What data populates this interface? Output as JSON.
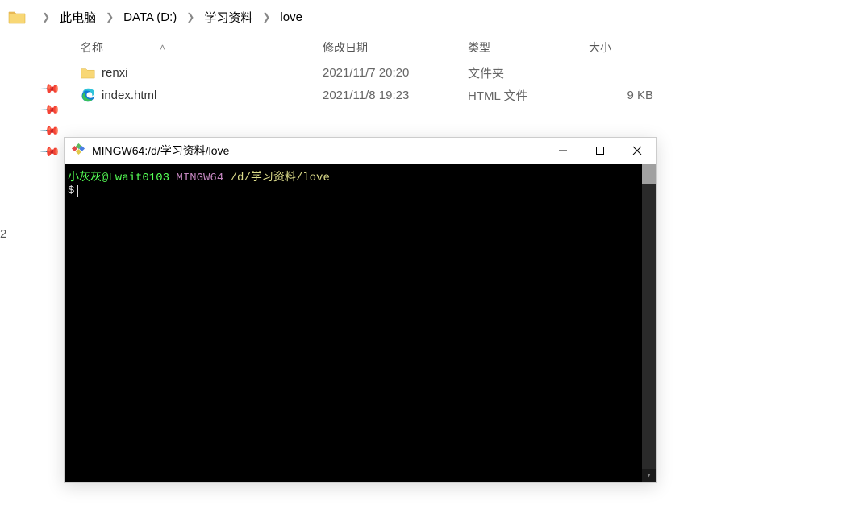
{
  "breadcrumb": {
    "segments": [
      "此电脑",
      "DATA (D:)",
      "学习资料",
      "love"
    ]
  },
  "columns": {
    "name": "名称",
    "date": "修改日期",
    "type": "类型",
    "size": "大小"
  },
  "files": [
    {
      "icon": "folder",
      "name": "renxi",
      "date": "2021/11/7 20:20",
      "type": "文件夹",
      "size": ""
    },
    {
      "icon": "edge",
      "name": "index.html",
      "date": "2021/11/8 19:23",
      "type": "HTML 文件",
      "size": "9 KB"
    }
  ],
  "left_strip": {
    "number": "2"
  },
  "terminal": {
    "title": "MINGW64:/d/学习资料/love",
    "prompt_user": "小灰灰@Lwait0103",
    "prompt_env": "MINGW64",
    "prompt_path": "/d/学习资料/love",
    "prompt_symbol": "$"
  }
}
